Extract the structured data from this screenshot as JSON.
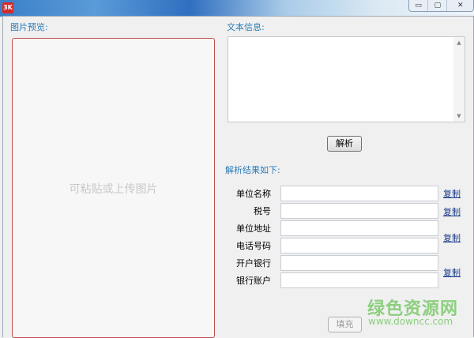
{
  "titlebar": {
    "icon_text": "3K",
    "controls": [
      "▭",
      "▢",
      "✕"
    ]
  },
  "preview": {
    "label": "图片预览:",
    "placeholder": "可粘贴或上传图片"
  },
  "text_info": {
    "label": "文本信息:",
    "value": ""
  },
  "parse_button": "解析",
  "results": {
    "label": "解析结果如下:",
    "fields": [
      {
        "label": "单位名称",
        "value": ""
      },
      {
        "label": "税号",
        "value": ""
      },
      {
        "label": "单位地址",
        "value": ""
      },
      {
        "label": "电话号码",
        "value": ""
      },
      {
        "label": "开户银行",
        "value": ""
      },
      {
        "label": "银行账户",
        "value": ""
      }
    ],
    "copy_label": "复制"
  },
  "fill_button": "填充",
  "watermark": {
    "name": "绿色资源网",
    "url": "www.downcc.com"
  }
}
